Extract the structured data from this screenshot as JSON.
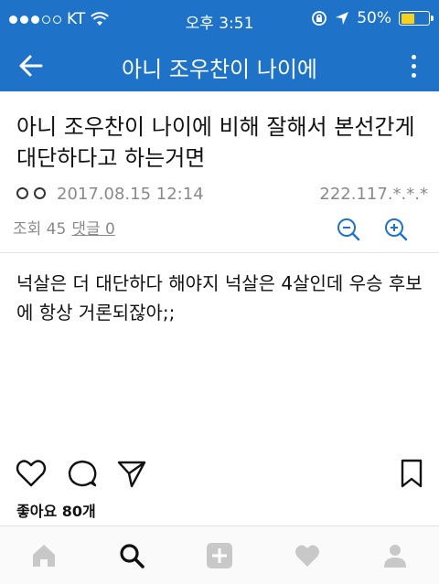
{
  "status_bar": {
    "carrier": "KT",
    "time": "오후 3:51",
    "battery_percent": "50%",
    "battery_level": 0.5,
    "icons": [
      "signal-dots",
      "wifi-icon",
      "rotation-lock-icon",
      "location-arrow-icon",
      "battery-icon"
    ]
  },
  "app_bar": {
    "title": "아니 조우찬이 나이에",
    "back_icon": "back-arrow-icon",
    "more_icon": "more-vertical-icon"
  },
  "post": {
    "title": "아니 조우찬이 나이에 비해 잘해서 본선간게 대단하다고 하는거면",
    "date": "2017.08.15 12:14",
    "ip": "222.117.*.*.*",
    "views": "조회 45",
    "comments": "댓글 0",
    "body": "넉살은 더 대단하다 해야지 넉살은 4살인데 우승 후보에 항상 거론되잖아;;",
    "zoom_out_icon": "zoom-out-icon",
    "zoom_in_icon": "zoom-in-icon"
  },
  "actions": {
    "likes": "좋아요 80개",
    "icons": [
      "heart-icon",
      "comment-icon",
      "share-icon",
      "bookmark-icon"
    ]
  },
  "bottom_nav": {
    "items": [
      "home-icon",
      "search-icon",
      "add-icon",
      "heart-icon",
      "profile-icon"
    ]
  },
  "colors": {
    "accent": "#1e73c8",
    "battery": "#f7d21b",
    "meta_gray": "#8a8a8a"
  }
}
